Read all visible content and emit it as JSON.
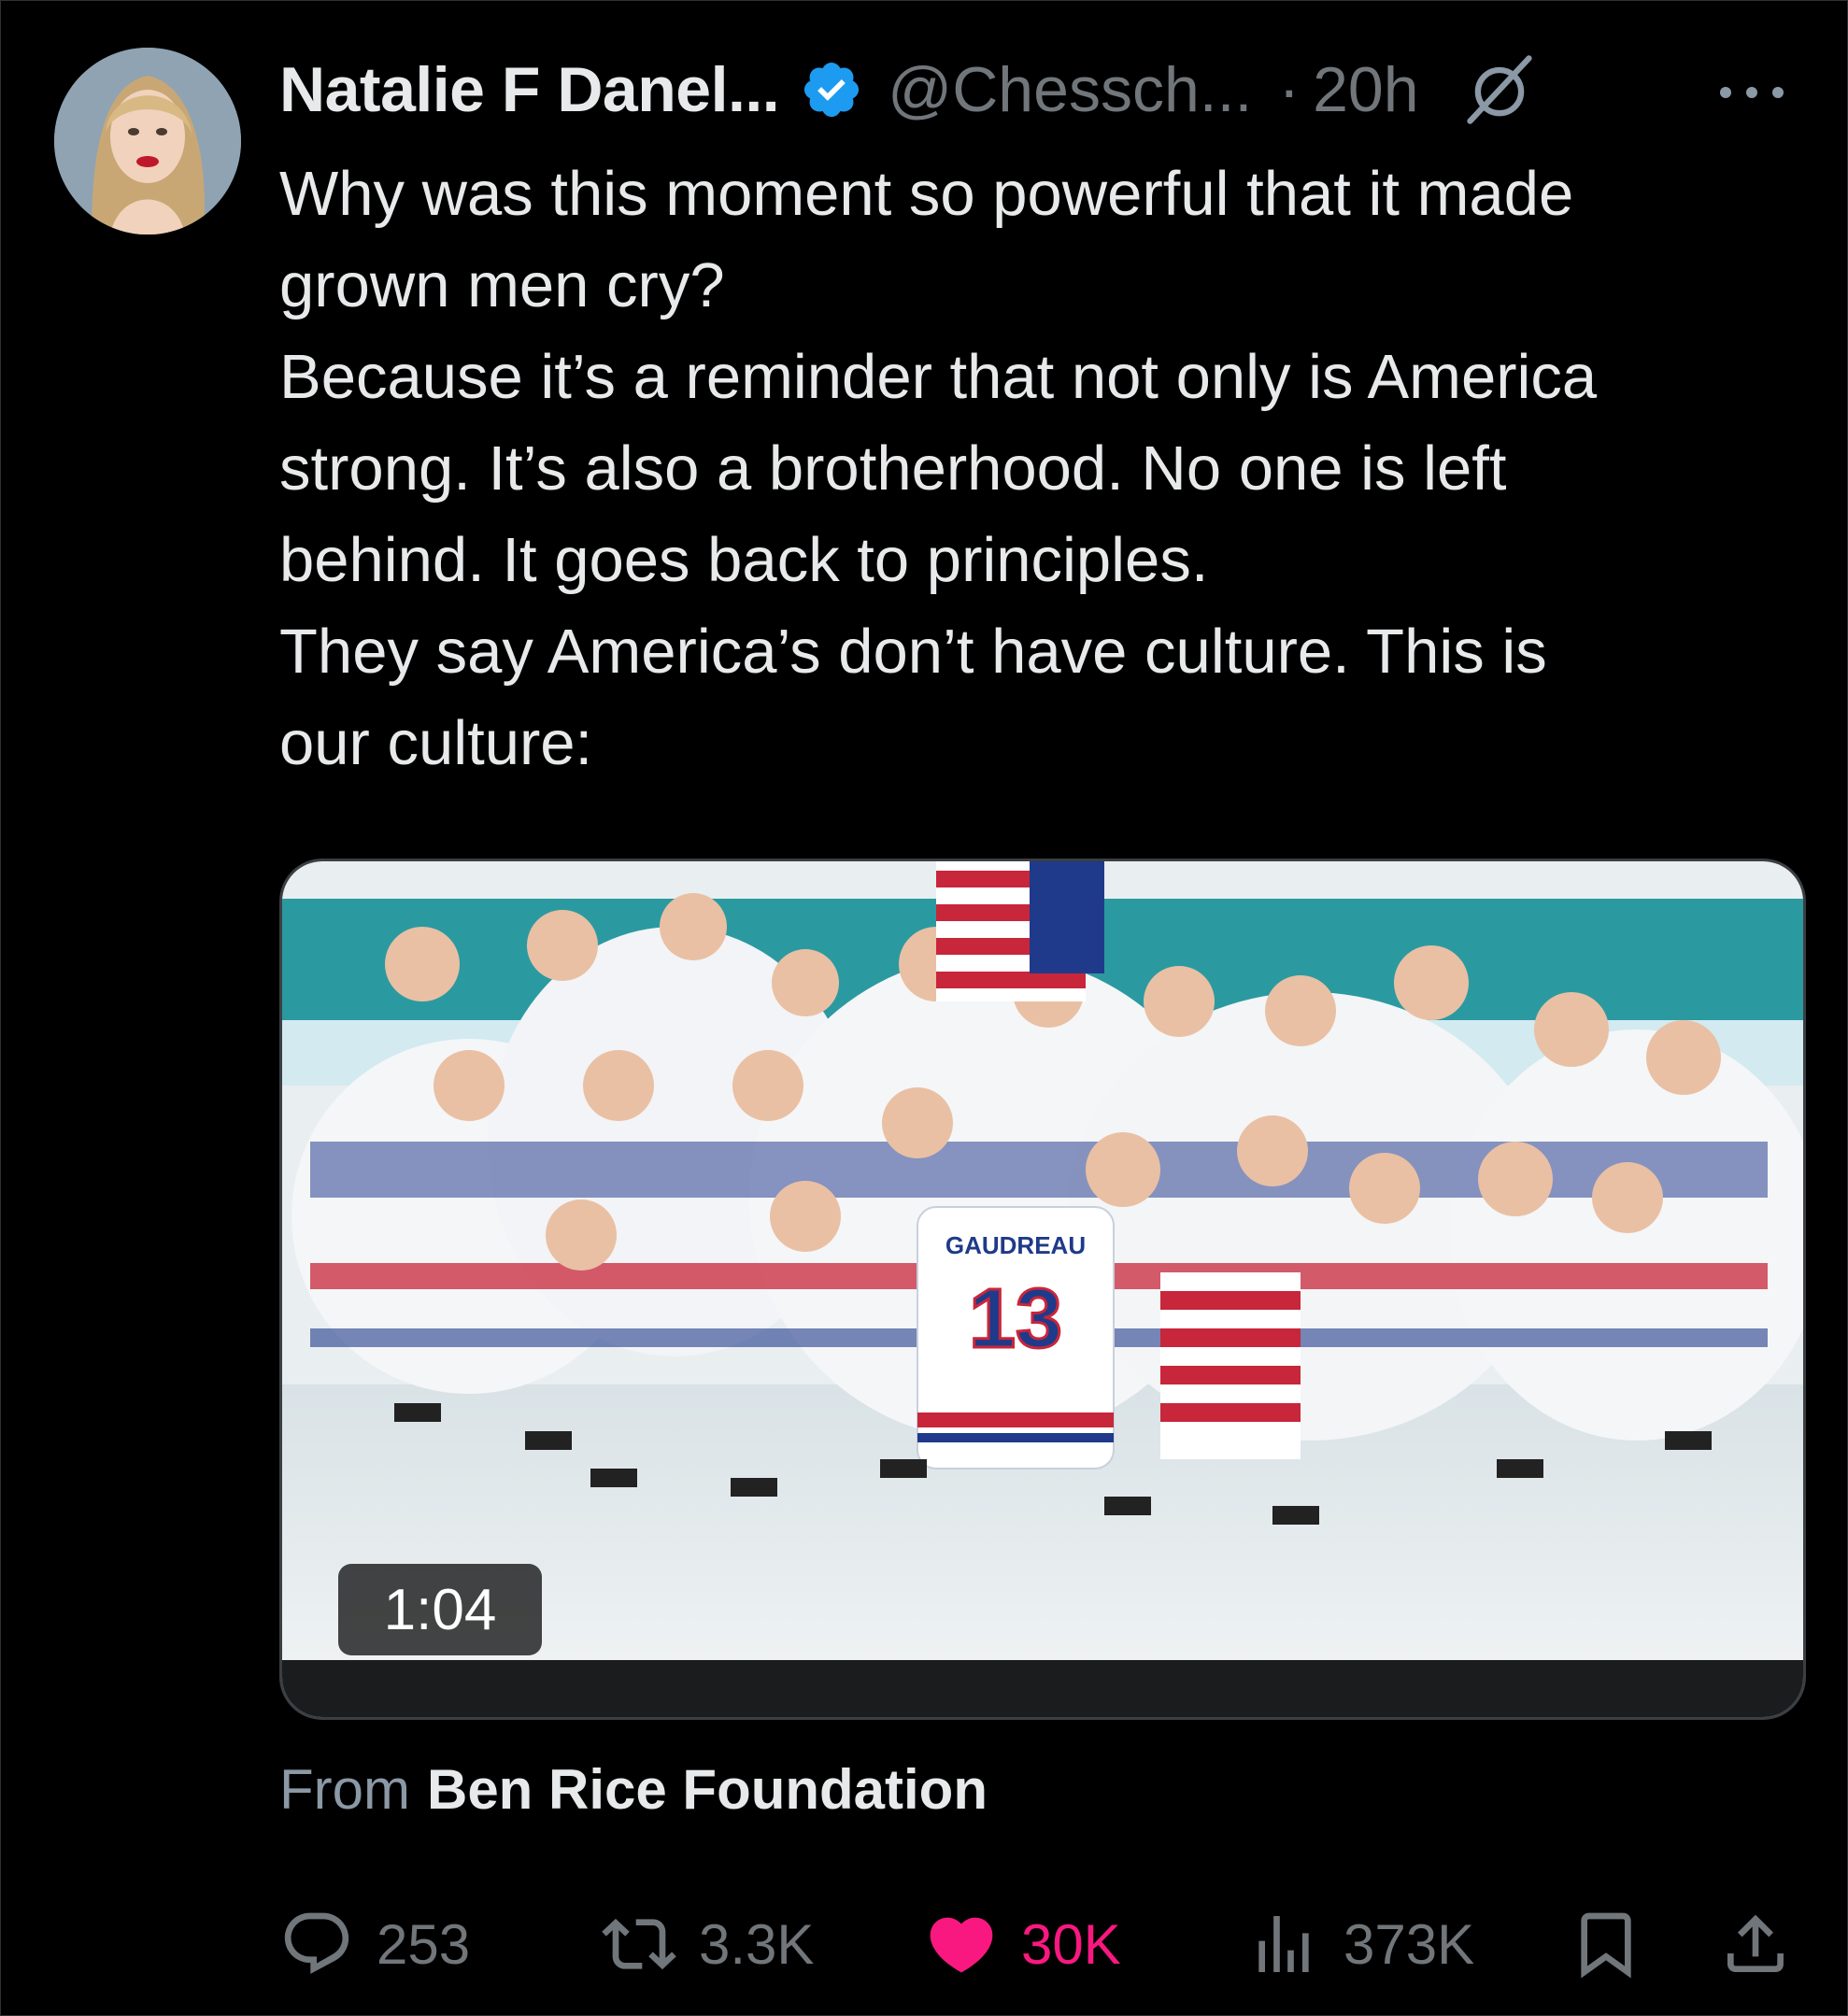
{
  "post": {
    "author_name": "Natalie F Danel...",
    "author_handle": "@Chessch...",
    "separator": "·",
    "timestamp": "20h",
    "verified_color": "#1d9bf0",
    "text_lines": [
      "Why was this moment so powerful that it made",
      "grown men cry?",
      "Because it’s a reminder that not only is America",
      "strong. It’s also a brotherhood. No one is left",
      "behind. It goes back to principles.",
      "They say America’s don’t have culture. This is",
      "our culture:"
    ]
  },
  "media": {
    "duration": "1:04",
    "jersey_name": "GAUDREAU",
    "jersey_number": "13"
  },
  "source": {
    "prefix": "From",
    "name": "Ben Rice Foundation"
  },
  "actions": {
    "replies": "253",
    "reposts": "3.3K",
    "likes": "30K",
    "views": "373K",
    "like_color": "#f91880"
  },
  "icons": [
    "grok-icon",
    "more-icon",
    "reply-icon",
    "repost-icon",
    "like-icon",
    "views-icon",
    "bookmark-icon",
    "share-icon"
  ]
}
